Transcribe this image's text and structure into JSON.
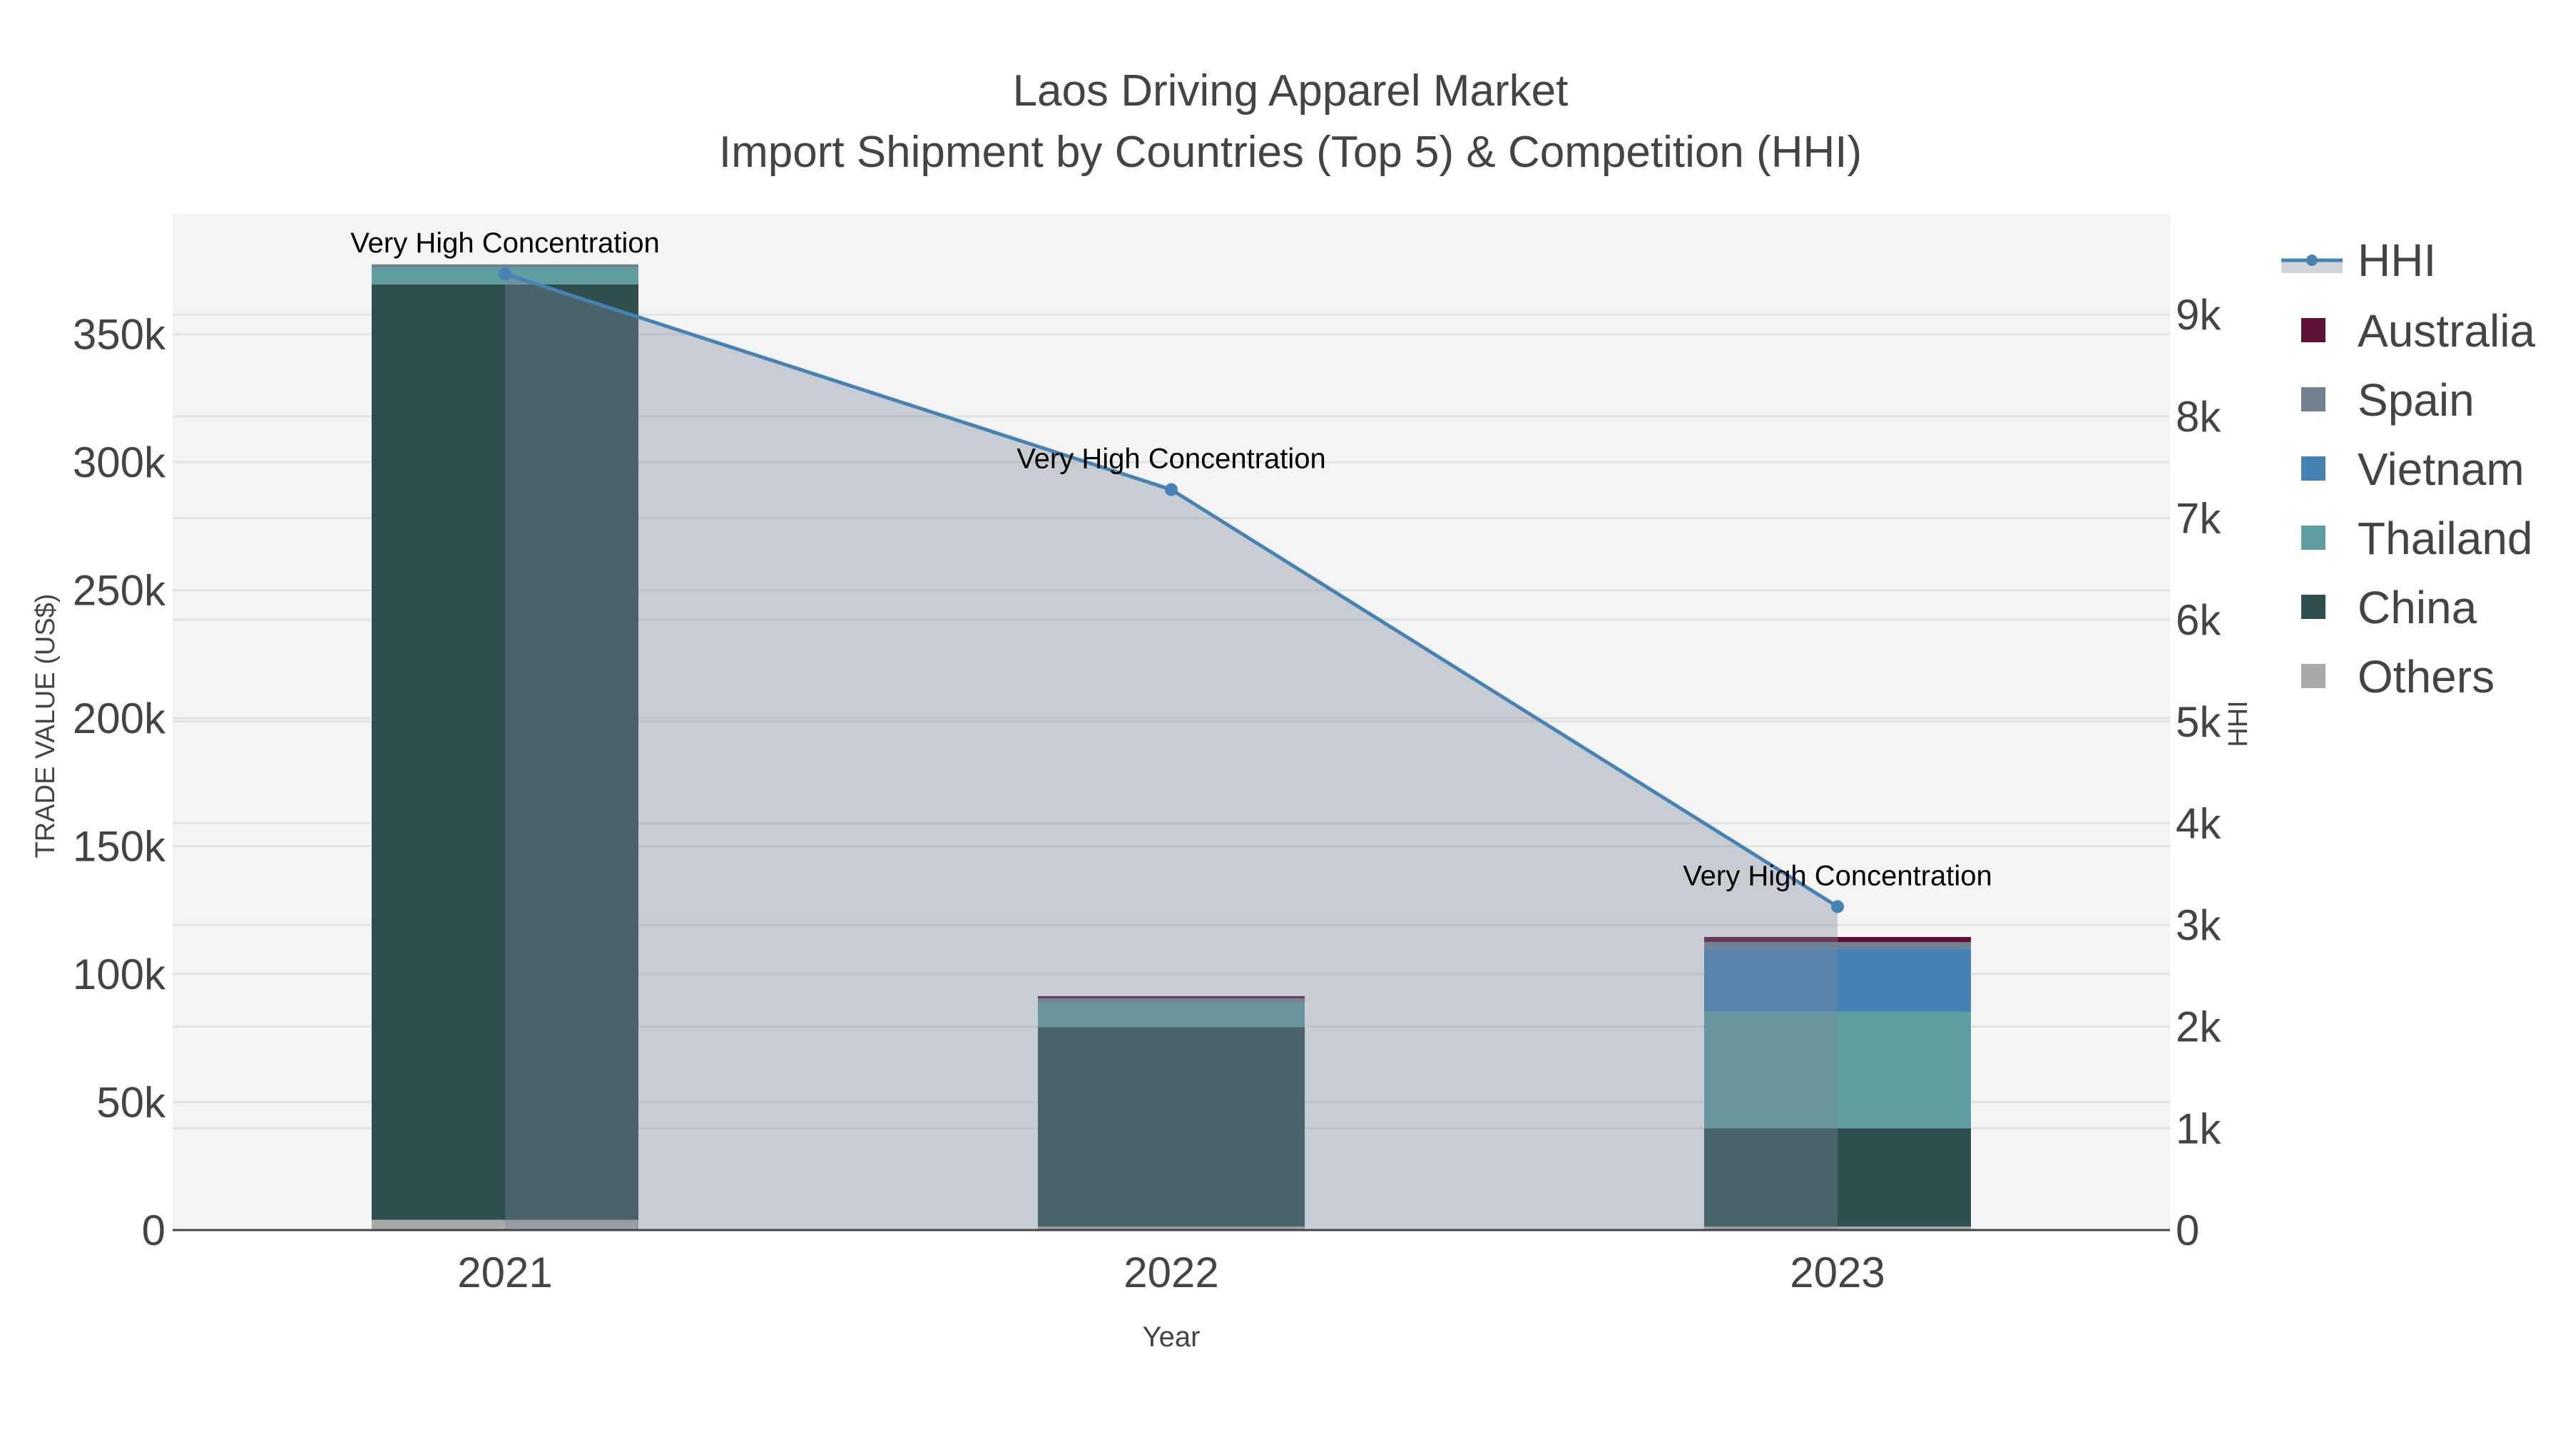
{
  "chart_data": {
    "type": "bar",
    "title": "Laos Driving Apparel Market",
    "subtitle": "Import Shipment by Countries (Top 5) & Competition (HHI)",
    "xlabel": "Year",
    "ylabel": "TRADE VALUE (US$)",
    "y2label": "HHI",
    "categories": [
      "2021",
      "2022",
      "2023"
    ],
    "ylim": [
      0,
      397000
    ],
    "y2lim": [
      0,
      9990
    ],
    "yticks": [
      0,
      50000,
      100000,
      150000,
      200000,
      250000,
      300000,
      350000
    ],
    "ytick_labels": [
      "0",
      "50k",
      "100k",
      "150k",
      "200k",
      "250k",
      "300k",
      "350k"
    ],
    "y2ticks": [
      0,
      1000,
      2000,
      3000,
      4000,
      5000,
      6000,
      7000,
      8000,
      9000
    ],
    "y2tick_labels": [
      "0",
      "1k",
      "2k",
      "3k",
      "4k",
      "5k",
      "6k",
      "7k",
      "8k",
      "9k"
    ],
    "stacked": true,
    "series": [
      {
        "name": "Others",
        "color": "#a9a9a9",
        "values": [
          4000,
          1400,
          1400
        ]
      },
      {
        "name": "China",
        "color": "#2f4f4f",
        "values": [
          365500,
          77900,
          38400
        ]
      },
      {
        "name": "Thailand",
        "color": "#5f9ea0",
        "values": [
          6600,
          9500,
          45500
        ]
      },
      {
        "name": "Vietnam",
        "color": "#4682b4",
        "values": [
          0,
          0,
          24700
        ]
      },
      {
        "name": "Spain",
        "color": "#708090",
        "values": [
          1200,
          1700,
          2500
        ]
      },
      {
        "name": "Australia",
        "color": "#5e1236",
        "values": [
          0,
          900,
          2000
        ]
      }
    ],
    "line": {
      "name": "HHI",
      "color": "#4682b4",
      "axis": "right",
      "values": [
        9400,
        7280,
        3180
      ],
      "annotations": [
        "Very High Concentration",
        "Very High Concentration",
        "Very High Concentration"
      ]
    },
    "legend_order": [
      "HHI",
      "Australia",
      "Spain",
      "Vietnam",
      "Thailand",
      "China",
      "Others"
    ],
    "legend_placement": "right",
    "grid": true
  }
}
